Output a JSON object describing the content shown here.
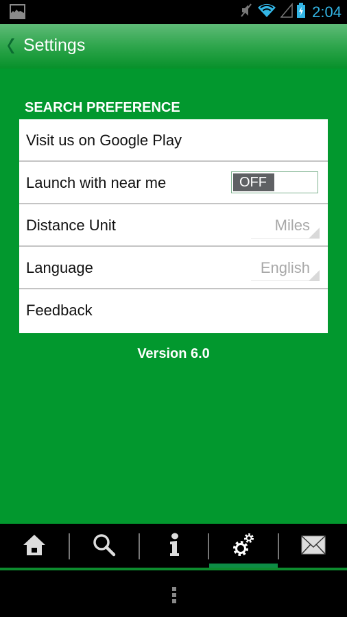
{
  "status_bar": {
    "time": "2:04",
    "icons": [
      "gallery-notification-icon",
      "mute-icon",
      "wifi-icon",
      "signal-icon",
      "battery-charging-icon"
    ]
  },
  "action_bar": {
    "back_icon": "chevron-left-icon",
    "title": "Settings"
  },
  "settings": {
    "section_header": "SEARCH PREFERENCE",
    "rows": [
      {
        "label": "Visit us on Google Play"
      },
      {
        "label": "Launch with near me",
        "toggle_state": "OFF"
      },
      {
        "label": "Distance Unit",
        "value": "Miles"
      },
      {
        "label": "Language",
        "value": "English"
      },
      {
        "label": "Feedback"
      }
    ],
    "version": "Version 6.0"
  },
  "bottom_nav": {
    "items": [
      {
        "name": "home",
        "icon": "home-icon"
      },
      {
        "name": "search",
        "icon": "search-icon"
      },
      {
        "name": "info",
        "icon": "info-icon"
      },
      {
        "name": "settings",
        "icon": "gears-icon",
        "active": true
      },
      {
        "name": "contact",
        "icon": "envelope-icon"
      }
    ],
    "accent_color": "#0d8c45"
  },
  "colors": {
    "background_green": "#02982e",
    "status_time_blue": "#33b5e5"
  },
  "system_nav": {
    "icon": "menu-overflow-icon"
  }
}
